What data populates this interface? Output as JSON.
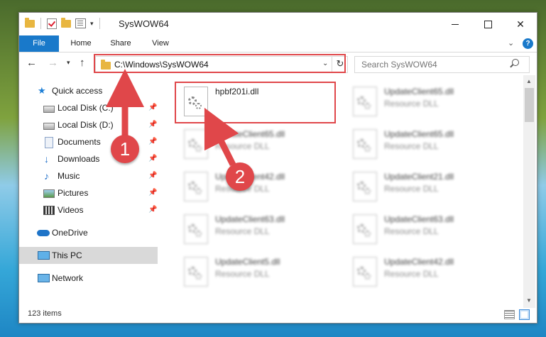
{
  "window": {
    "title": "SysWOW64"
  },
  "ribbon": {
    "tabs": [
      {
        "label": "File"
      },
      {
        "label": "Home"
      },
      {
        "label": "Share"
      },
      {
        "label": "View"
      }
    ]
  },
  "address": {
    "path": "C:\\Windows\\SysWOW64",
    "search_placeholder": "Search SysWOW64"
  },
  "sidebar": {
    "items": [
      {
        "label": "Quick access",
        "icon": "star-icon"
      },
      {
        "label": "Local Disk (C:)",
        "icon": "disk-icon",
        "pinned": true
      },
      {
        "label": "Local Disk (D:)",
        "icon": "disk-icon",
        "pinned": true
      },
      {
        "label": "Documents",
        "icon": "documents-icon",
        "pinned": true
      },
      {
        "label": "Downloads",
        "icon": "download-icon",
        "pinned": true
      },
      {
        "label": "Music",
        "icon": "music-icon",
        "pinned": true
      },
      {
        "label": "Pictures",
        "icon": "pictures-icon",
        "pinned": true
      },
      {
        "label": "Videos",
        "icon": "videos-icon",
        "pinned": true
      },
      {
        "label": "OneDrive",
        "icon": "cloud-icon"
      },
      {
        "label": "This PC",
        "icon": "computer-icon",
        "selected": true
      },
      {
        "label": "Network",
        "icon": "network-icon"
      }
    ]
  },
  "files": [
    {
      "name": "hpbf201i.dll",
      "type": ""
    },
    {
      "name": "UpdateClient65.dll",
      "type": "Resource DLL"
    },
    {
      "name": "UpdateClient65.dll",
      "type": "Resource DLL"
    },
    {
      "name": "UpdateClient65.dll",
      "type": "Resource DLL"
    },
    {
      "name": "UpdateClient42.dll",
      "type": "Resource DLL"
    },
    {
      "name": "UpdateClient21.dll",
      "type": "Resource DLL"
    },
    {
      "name": "UpdateClient63.dll",
      "type": "Resource DLL"
    },
    {
      "name": "UpdateClient63.dll",
      "type": "Resource DLL"
    },
    {
      "name": "UpdateClient5.dll",
      "type": "Resource DLL"
    },
    {
      "name": "UpdateClient42.dll",
      "type": "Resource DLL"
    }
  ],
  "status": {
    "item_count": "123 items"
  },
  "annotations": {
    "marker1": "1",
    "marker2": "2",
    "color": "#e0474a"
  },
  "colors": {
    "accent": "#1979ca",
    "highlight": "#e0474a"
  }
}
